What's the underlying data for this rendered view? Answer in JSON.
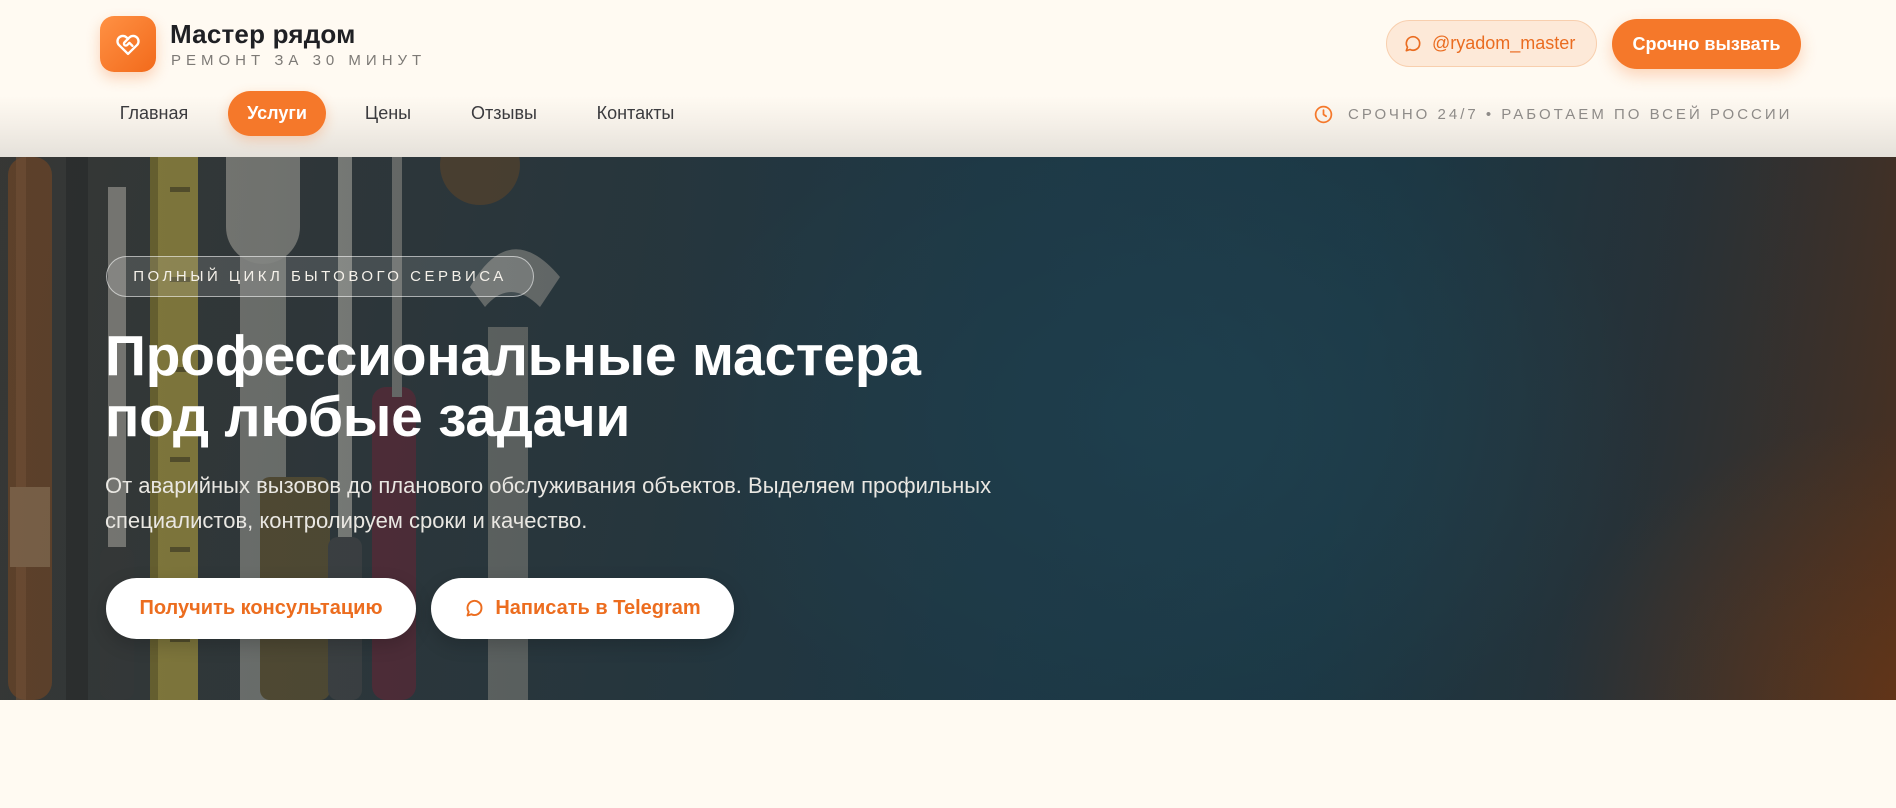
{
  "brand": {
    "name": "Мастер рядом",
    "tagline": "РЕМОНТ ЗА 30 МИНУТ",
    "logo_icon": "heart-handshake-icon",
    "accent_color": "#f5782a"
  },
  "header": {
    "telegram_handle": "@ryadom_master",
    "telegram_icon": "chat-bubble-icon",
    "call_button": "Срочно вызвать",
    "status_icon": "clock-icon",
    "status_text": "СРОЧНО 24/7 • РАБОТАЕМ ПО ВСЕЙ РОССИИ"
  },
  "nav": {
    "items": [
      {
        "label": "Главная",
        "active": false
      },
      {
        "label": "Услуги",
        "active": true
      },
      {
        "label": "Цены",
        "active": false
      },
      {
        "label": "Отзывы",
        "active": false
      },
      {
        "label": "Контакты",
        "active": false
      }
    ]
  },
  "hero": {
    "pill": "ПОЛНЫЙ ЦИКЛ БЫТОВОГО СЕРВИСА",
    "title_line1": "Профессиональные мастера",
    "title_line2": "под любые задачи",
    "subtitle_line1": "От аварийных вызовов до планового обслуживания объектов. Выделяем профильных",
    "subtitle_line2": "специалистов, контролируем сроки и качество.",
    "primary_button": "Получить консультацию",
    "secondary_button": "Написать в Telegram",
    "secondary_icon": "chat-bubble-icon",
    "background": "tools-photo"
  }
}
